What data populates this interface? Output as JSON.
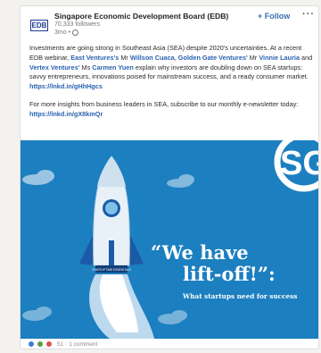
{
  "post": {
    "logo_text": "EDB",
    "author": "Singapore Economic Development Board (EDB)",
    "followers": "70,333 followers",
    "age": "3mo",
    "follow_label": "+ Follow",
    "more_label": "···"
  },
  "body": {
    "p1_a": "Investments are going strong in Southeast Asia (SEA) despite 2020's uncertainties. At a recent EDB webinar, ",
    "east_ventures": "East Ventures's",
    "p1_b": " Mr ",
    "willson": "Willson Cuaca",
    "p1_c": ", ",
    "golden_gate": "Golden Gate Ventures'",
    "p1_d": " Mr ",
    "vinnie": "Vinnie Lauria",
    "p1_e": " and ",
    "vertex": "Vertex Ventures'",
    "p1_f": " Ms ",
    "carmen": "Carmen Yuen",
    "p1_g": " explain why investors are doubling down on SEA startups: savvy entrepreneurs, innovations poised for mainstream success, and a ready consumer market. ",
    "link1": "https://lnkd.in/gHhHgcs",
    "p2": "For more insights from business leaders in SEA, subscribe to our monthly e-newsletter today: ",
    "link2": "https://lnkd.in/gX8kmQr"
  },
  "banner": {
    "sg_text": "SG",
    "headline_1": "“We have",
    "headline_2": "lift-off!”:",
    "subline": "What startups need for success",
    "rocket_label": "STARTUP TIME ESSENTIALS"
  },
  "reactions": {
    "count": "51",
    "comments": "· 1 comment"
  },
  "colors": {
    "banner_bg": "#1c7fc0",
    "link": "#2a63b0",
    "rocket_fin": "#1a5aa6"
  }
}
